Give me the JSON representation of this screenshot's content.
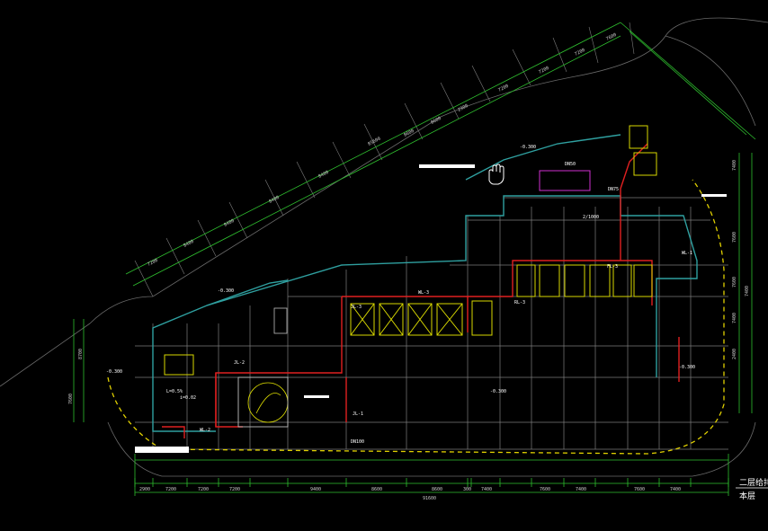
{
  "title_block": {
    "line1": "二层给排",
    "line2": "本层"
  },
  "colors": {
    "background": "#000000",
    "grid": "#8a8a8a",
    "dimension": "#2fbf2f",
    "wall": "#2fa0a0",
    "pipe": "#e02020",
    "shaft": "#d8d800",
    "fixture": "#d030d0",
    "edge_dash": "#e0d000"
  },
  "icons": {
    "cursor": "hand-cursor-icon"
  },
  "dimensions": {
    "bottom_segments": [
      "2900",
      "7200",
      "7200",
      "7200",
      "9400",
      "8600",
      "8600",
      "300",
      "7400",
      "7600",
      "7400",
      "7600",
      "7400"
    ],
    "bottom_total": "91600",
    "diagonal_segments": [
      "7200",
      "8400",
      "8400",
      "8400",
      "8400",
      "8600",
      "8600",
      "2900",
      "7200",
      "7200",
      "7200",
      "7600"
    ],
    "diagonal_total": "85600",
    "right_segments": [
      "7400",
      "7600",
      "7600",
      "7400",
      "2400",
      "7400"
    ],
    "left_segments": [
      "7600",
      "8700"
    ]
  },
  "elevations": {
    "left": "-0.300",
    "left_lower": "-0.300",
    "center": "-0.300",
    "top": "-0.300",
    "right": "-0.300"
  },
  "labels": {
    "riser_a": "JL-3",
    "riser_b": "WL-3",
    "riser_c": "RL-3",
    "riser_d": "FL-3",
    "riser_e": "JL-2",
    "riser_f": "WL-2",
    "riser_g": "JL-1",
    "riser_h": "WL-1",
    "dn_a": "DN100",
    "dn_b": "DN50",
    "dn_c": "DN75",
    "room_a": "2/1000",
    "note_a": "L=0.5%",
    "note_b": "i=0.02"
  }
}
